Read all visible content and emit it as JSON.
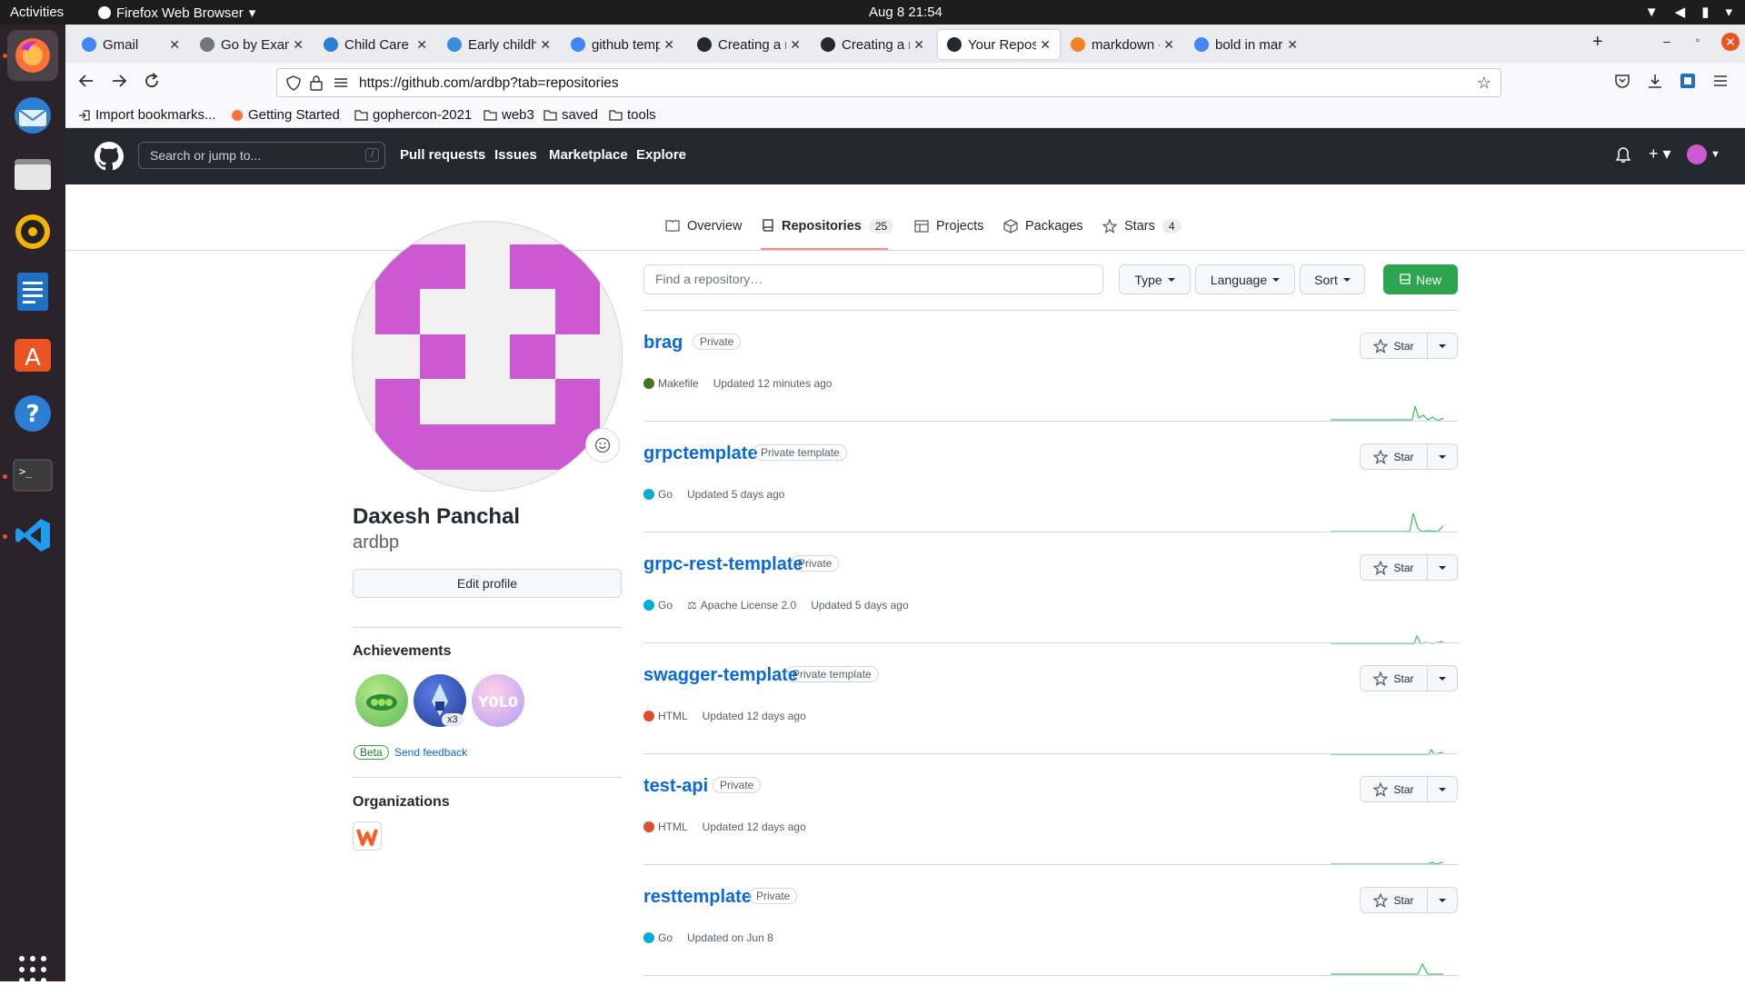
{
  "os": {
    "activities": "Activities",
    "app_name": "Firefox Web Browser",
    "clock": "Aug 8  21:54"
  },
  "tabs": [
    {
      "title": "Gmail",
      "favicon": "google-icon"
    },
    {
      "title": "Go by Example: I",
      "favicon": "code-icon"
    },
    {
      "title": "Child Care Digita",
      "favicon": "childcare-icon"
    },
    {
      "title": "Early childhood c",
      "favicon": "wiki-icon"
    },
    {
      "title": "github template",
      "favicon": "google-icon"
    },
    {
      "title": "Creating a repos",
      "favicon": "github-icon"
    },
    {
      "title": "Creating a repos",
      "favicon": "github-icon"
    },
    {
      "title": "Your Repositorie",
      "favicon": "github-icon",
      "selected": true
    },
    {
      "title": "markdown - How",
      "favicon": "stackoverflow-icon"
    },
    {
      "title": "bold in markdow",
      "favicon": "google-icon"
    }
  ],
  "url": "https://github.com/ardbp?tab=repositories",
  "bookmarks": [
    "Import bookmarks...",
    "Getting Started",
    "gophercon-2021",
    "web3",
    "saved",
    "tools"
  ],
  "github": {
    "search_placeholder": "Search or jump to...",
    "search_shortcut": "/",
    "nav": [
      "Pull requests",
      "Issues",
      "Marketplace",
      "Explore"
    ]
  },
  "profile_tabs": [
    {
      "label": "Overview",
      "icon": "book-icon"
    },
    {
      "label": "Repositories",
      "count": "25",
      "icon": "repo-icon",
      "selected": true
    },
    {
      "label": "Projects",
      "icon": "table-icon"
    },
    {
      "label": "Packages",
      "icon": "package-icon"
    },
    {
      "label": "Stars",
      "count": "4",
      "icon": "star-icon"
    }
  ],
  "profile": {
    "name": "Daxesh Panchal",
    "login": "ardbp",
    "edit_label": "Edit profile",
    "achievements_title": "Achievements",
    "achievement_count": "x3",
    "beta_label": "Beta",
    "feedback_label": "Send feedback",
    "organizations_title": "Organizations",
    "avatar_color": "#cc59d2"
  },
  "filters": {
    "find_placeholder": "Find a repository…",
    "type": "Type",
    "language": "Language",
    "sort": "Sort",
    "new": "New"
  },
  "star_label": "Star",
  "repos": [
    {
      "name": "brag",
      "visibility": "Private",
      "language": "Makefile",
      "lang_color": "#427819",
      "license": "",
      "updated": "Updated 12 minutes ago"
    },
    {
      "name": "grpctemplate",
      "visibility": "Private template",
      "language": "Go",
      "lang_color": "#00ADD8",
      "license": "",
      "updated": "Updated 5 days ago"
    },
    {
      "name": "grpc-rest-template",
      "visibility": "Private",
      "language": "Go",
      "lang_color": "#00ADD8",
      "license": "Apache License 2.0",
      "updated": "Updated 5 days ago"
    },
    {
      "name": "swagger-template",
      "visibility": "Private template",
      "language": "HTML",
      "lang_color": "#e34c26",
      "license": "",
      "updated": "Updated 12 days ago"
    },
    {
      "name": "test-api",
      "visibility": "Private",
      "language": "HTML",
      "lang_color": "#e34c26",
      "license": "",
      "updated": "Updated 12 days ago"
    },
    {
      "name": "resttemplate",
      "visibility": "Private",
      "language": "Go",
      "lang_color": "#00ADD8",
      "license": "",
      "updated": "Updated on Jun 8"
    }
  ]
}
